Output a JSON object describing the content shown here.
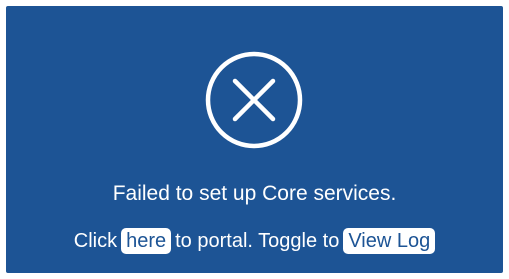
{
  "status": {
    "icon": "error-circle-x-icon",
    "message": "Failed to set up Core services."
  },
  "actions": {
    "prefix": "Click",
    "here_link": "here",
    "middle": "to portal. Toggle to",
    "view_log_button": "View Log"
  },
  "colors": {
    "panel_background": "#1d5495",
    "foreground": "#ffffff"
  }
}
